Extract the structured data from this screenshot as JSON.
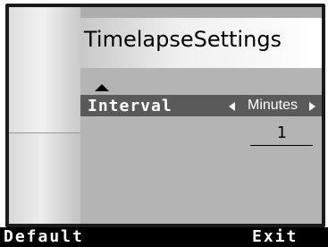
{
  "screen": {
    "title": "TimelapseSettings"
  },
  "menu": {
    "items": [
      {
        "label": "Interval",
        "unit": "Minutes",
        "value": "1"
      }
    ]
  },
  "softkeys": {
    "left": "Default",
    "right": "Exit"
  },
  "icons": {
    "scroll_up": "triangle-up-icon",
    "unit_prev": "triangle-left-icon",
    "unit_next": "triangle-right-icon"
  },
  "colors": {
    "background": "#aeaeae",
    "selected_row": "#5a5a5a",
    "softkey_bar": "#000000",
    "text_selected": "#ffffff"
  }
}
